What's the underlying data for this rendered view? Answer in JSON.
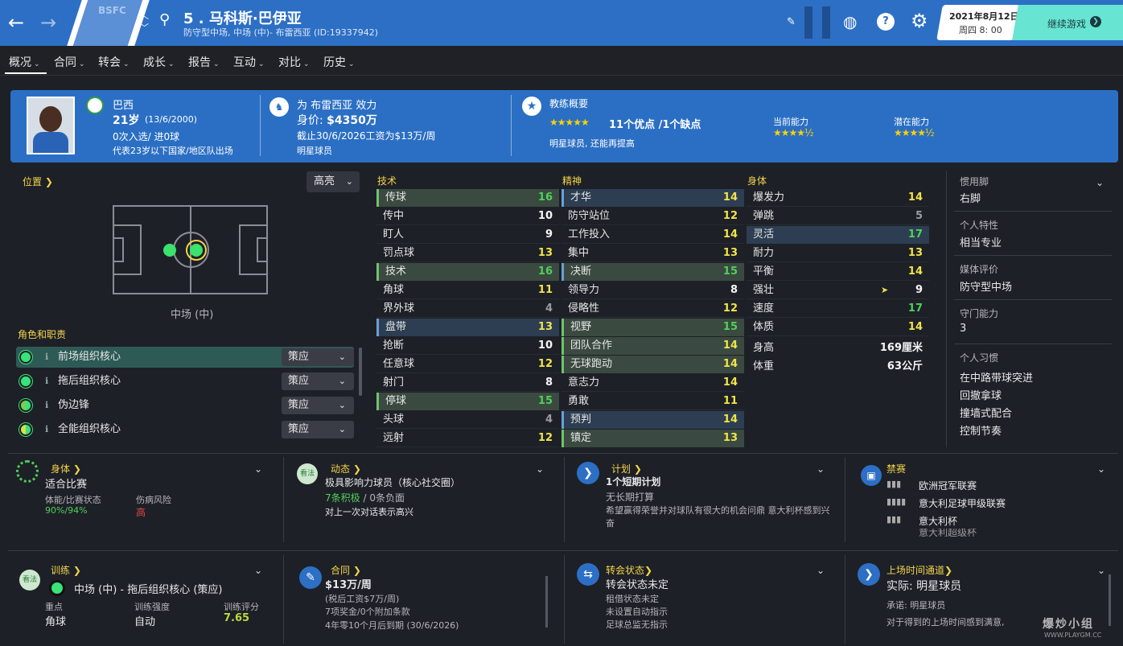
{
  "header": {
    "club_abbr": "BSFC",
    "player_title": "5 . 马科斯·巴伊亚",
    "player_subtitle": "防守型中场, 中场 (中)- 布雷西亚 (ID:19337942)",
    "date": "2021年8月12日",
    "weekday_time": "周四 8: 00",
    "continue_label": "继续游戏"
  },
  "menu": [
    "概况",
    "合同",
    "转会",
    "成长",
    "报告",
    "互动",
    "对比",
    "历史"
  ],
  "band": {
    "nation": "巴西",
    "age": "21岁",
    "dob": "(13/6/2000)",
    "caps": "0次入选/ 进0球",
    "u23": "代表23岁以下国家/地区队出场",
    "plays_for": "为 布雷西亚 效力",
    "value_label": "身价: ",
    "value": "$4350万",
    "contract": "截止30/6/2026工资为$13万/周",
    "status": "明星球员",
    "coach_title": "教练概要",
    "pros_cons_a": "11个优点 /",
    "pros_cons_b": "1个缺点",
    "coach_summary": "明星球员, 还能再提高",
    "ca_label": "当前能力",
    "pa_label": "潜在能力",
    "coach_stars": "★★★★★",
    "ca_stars": "★★★★½",
    "pa_stars": "★★★★½"
  },
  "position": {
    "label": "位置",
    "highlight": "高亮",
    "pitch_caption": "中场 (中)",
    "roles_label": "角色和职责",
    "roles": [
      {
        "name": "前场组织核心",
        "duty": "策应"
      },
      {
        "name": "拖后组织核心",
        "duty": "策应"
      },
      {
        "name": "伪边锋",
        "duty": "策应"
      },
      {
        "name": "全能组织核心",
        "duty": "策应"
      }
    ]
  },
  "attributes": {
    "technical_title": "技术",
    "mental_title": "精神",
    "physical_title": "身体",
    "technical": [
      {
        "name": "传球",
        "value": "16"
      },
      {
        "name": "传中",
        "value": "10"
      },
      {
        "name": "盯人",
        "value": "9"
      },
      {
        "name": "罚点球",
        "value": "13"
      },
      {
        "name": "技术",
        "value": "16"
      },
      {
        "name": "角球",
        "value": "11"
      },
      {
        "name": "界外球",
        "value": "4"
      },
      {
        "name": "盘带",
        "value": "13"
      },
      {
        "name": "抢断",
        "value": "10"
      },
      {
        "name": "任意球",
        "value": "12"
      },
      {
        "name": "射门",
        "value": "8"
      },
      {
        "name": "停球",
        "value": "15"
      },
      {
        "name": "头球",
        "value": "4"
      },
      {
        "name": "远射",
        "value": "12"
      }
    ],
    "mental": [
      {
        "name": "才华",
        "value": "14"
      },
      {
        "name": "防守站位",
        "value": "12"
      },
      {
        "name": "工作投入",
        "value": "14"
      },
      {
        "name": "集中",
        "value": "13"
      },
      {
        "name": "决断",
        "value": "15"
      },
      {
        "name": "领导力",
        "value": "8"
      },
      {
        "name": "侵略性",
        "value": "12"
      },
      {
        "name": "视野",
        "value": "15"
      },
      {
        "name": "团队合作",
        "value": "14"
      },
      {
        "name": "无球跑动",
        "value": "14"
      },
      {
        "name": "意志力",
        "value": "14"
      },
      {
        "name": "勇敢",
        "value": "11"
      },
      {
        "name": "预判",
        "value": "14"
      },
      {
        "name": "镇定",
        "value": "13"
      }
    ],
    "physical": [
      {
        "name": "爆发力",
        "value": "14"
      },
      {
        "name": "弹跳",
        "value": "5"
      },
      {
        "name": "灵活",
        "value": "17"
      },
      {
        "name": "耐力",
        "value": "13"
      },
      {
        "name": "平衡",
        "value": "14"
      },
      {
        "name": "强壮",
        "value": "9"
      },
      {
        "name": "速度",
        "value": "17"
      },
      {
        "name": "体质",
        "value": "14"
      }
    ],
    "height_label": "身高",
    "height": "169厘米",
    "weight_label": "体重",
    "weight": "63公斤"
  },
  "side": {
    "foot_label": "惯用脚",
    "foot": "右脚",
    "trait_label": "个人特性",
    "trait": "相当专业",
    "media_label": "媒体评价",
    "media": "防守型中场",
    "gk_label": "守门能力",
    "gk": "3",
    "habits_label": "个人习惯",
    "habits": [
      "在中路带球突进",
      "回撤拿球",
      "撞墙式配合",
      "控制节奏"
    ]
  },
  "cards": {
    "fitness_title": "身体",
    "fitness_state": "适合比赛",
    "fitness_label": "体能/比赛状态",
    "fitness_value": "90%/94%",
    "injury_label": "伤病风险",
    "injury_value": "高",
    "dynamics_title": "动态",
    "dynamics_badge": "看法",
    "dynamics_role": "极具影响力球员（核心社交圈）",
    "dynamics_pos": "7条积极",
    "dynamics_neg": " / 0条负面",
    "dynamics_note": "对上一次对话表示高兴",
    "plan_title": "计划",
    "plan_head": "1个短期计划",
    "plan_sub": "无长期打算",
    "plan_text": "希望赢得荣誉并对球队有很大的机会问鼎 意大利杯感到兴奋",
    "ban_title": "禁赛",
    "bans": [
      "欧洲冠军联赛",
      "意大利足球甲级联赛",
      "意大利杯",
      "意大利超级杯"
    ],
    "train_title": "训练",
    "train_badge": "看法",
    "train_role": "中场 (中) - 拖后组织核心 (策应)",
    "train_focus_label": "重点",
    "train_focus": "角球",
    "train_int_label": "训练强度",
    "train_int": "自动",
    "train_rate_label": "训练评分",
    "train_rate": "7.65",
    "contract_title": "合同",
    "contract_wage": "$13万/周",
    "contract_tax": "(税后工资$7万/周)",
    "contract_bonus": "7项奖金/0个附加条款",
    "contract_expiry": "4年零10个月后到期 (30/6/2026)",
    "transfer_title": "转会状态",
    "transfer_head": "转会状态未定",
    "transfer_l1": "租借状态未定",
    "transfer_l2": "未设置自动指示",
    "transfer_l3": "足球总监无指示",
    "time_title": "上场时间通道",
    "time_head": "实际: 明星球员",
    "time_promise": "承诺: 明星球员",
    "time_note": "对于得到的上场时间感到满意,",
    "watermark": "爆炒小组",
    "watermark_sub": "WWW.PLAYGM.CC"
  },
  "colors": {
    "accent": "#2c6fc5",
    "green": "#4fd05a",
    "yellow": "#f0e44a",
    "title": "#f2d44a"
  }
}
